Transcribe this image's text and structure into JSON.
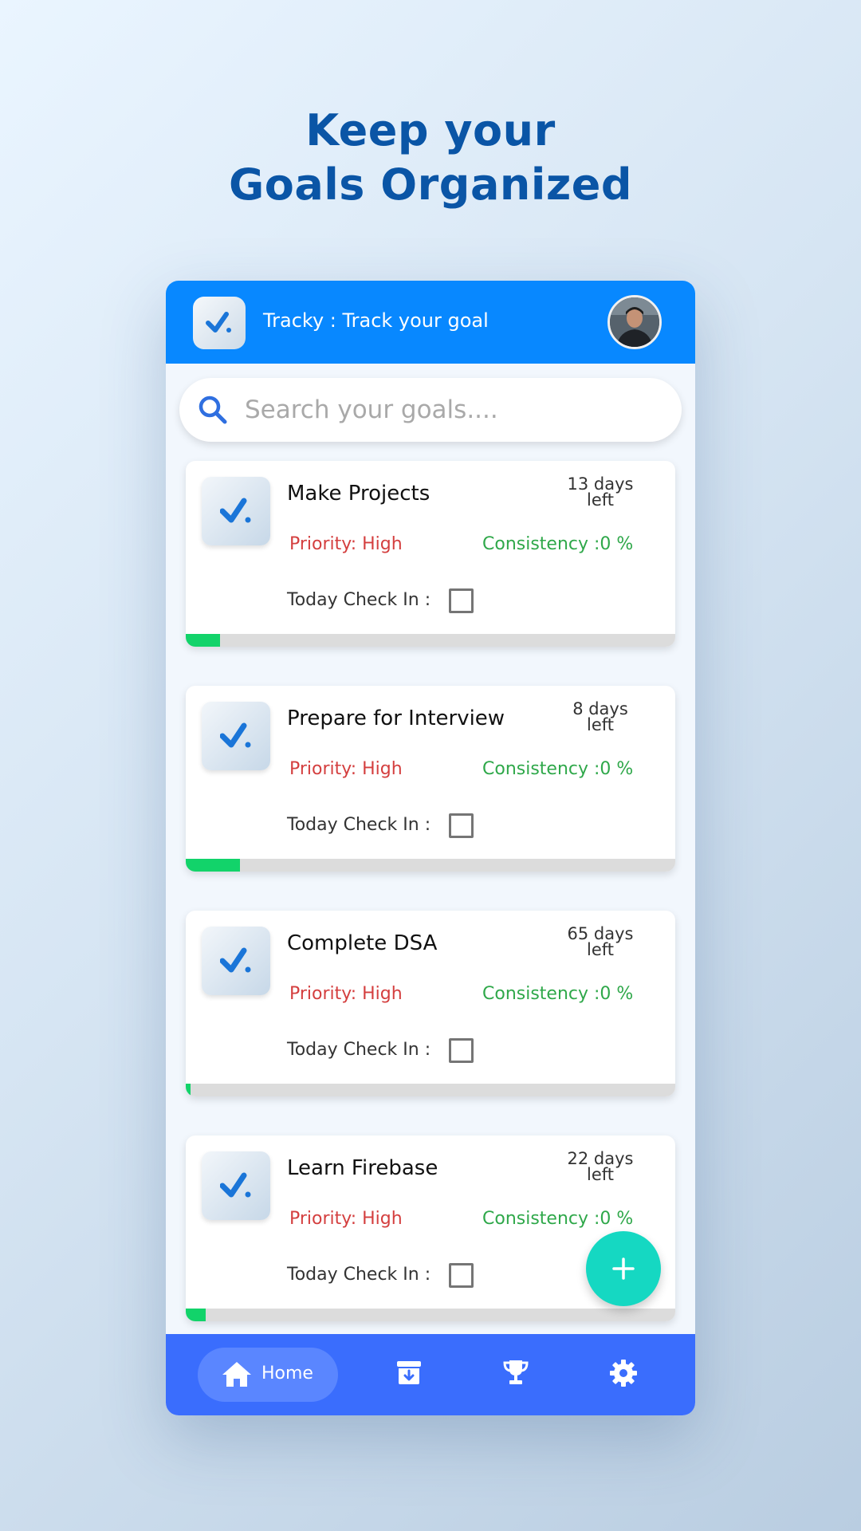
{
  "headline": {
    "line1": "Keep your",
    "line2": "Goals Organized"
  },
  "app": {
    "title": "Tracky : Track your goal"
  },
  "search": {
    "placeholder": "Search your goals...."
  },
  "goals": [
    {
      "title": "Make Projects",
      "days": "13 days",
      "left": "left",
      "priority": "Priority: High",
      "consistency": "Consistency :0 %",
      "checkin": "Today Check In :",
      "progress": 0.07
    },
    {
      "title": "Prepare for Interview",
      "days": "8 days",
      "left": "left",
      "priority": "Priority: High",
      "consistency": "Consistency :0 %",
      "checkin": "Today Check In :",
      "progress": 0.11
    },
    {
      "title": "Complete DSA",
      "days": "65 days",
      "left": "left",
      "priority": "Priority: High",
      "consistency": "Consistency :0 %",
      "checkin": "Today Check In :",
      "progress": 0.01
    },
    {
      "title": "Learn Firebase",
      "days": "22 days",
      "left": "left",
      "priority": "Priority: High",
      "consistency": "Consistency :0 %",
      "checkin": "Today Check In :",
      "progress": 0.04
    }
  ],
  "nav": {
    "home": "Home",
    "icons": [
      "home-icon",
      "archive-icon",
      "trophy-icon",
      "settings-icon"
    ]
  },
  "colors": {
    "appbar": "#0888ff",
    "nav": "#3a6dfd",
    "fab": "#15d8c2",
    "progress": "#12d36a",
    "priority": "#d43f3f",
    "consistency": "#2fa84a",
    "headline": "#0a55a6"
  }
}
